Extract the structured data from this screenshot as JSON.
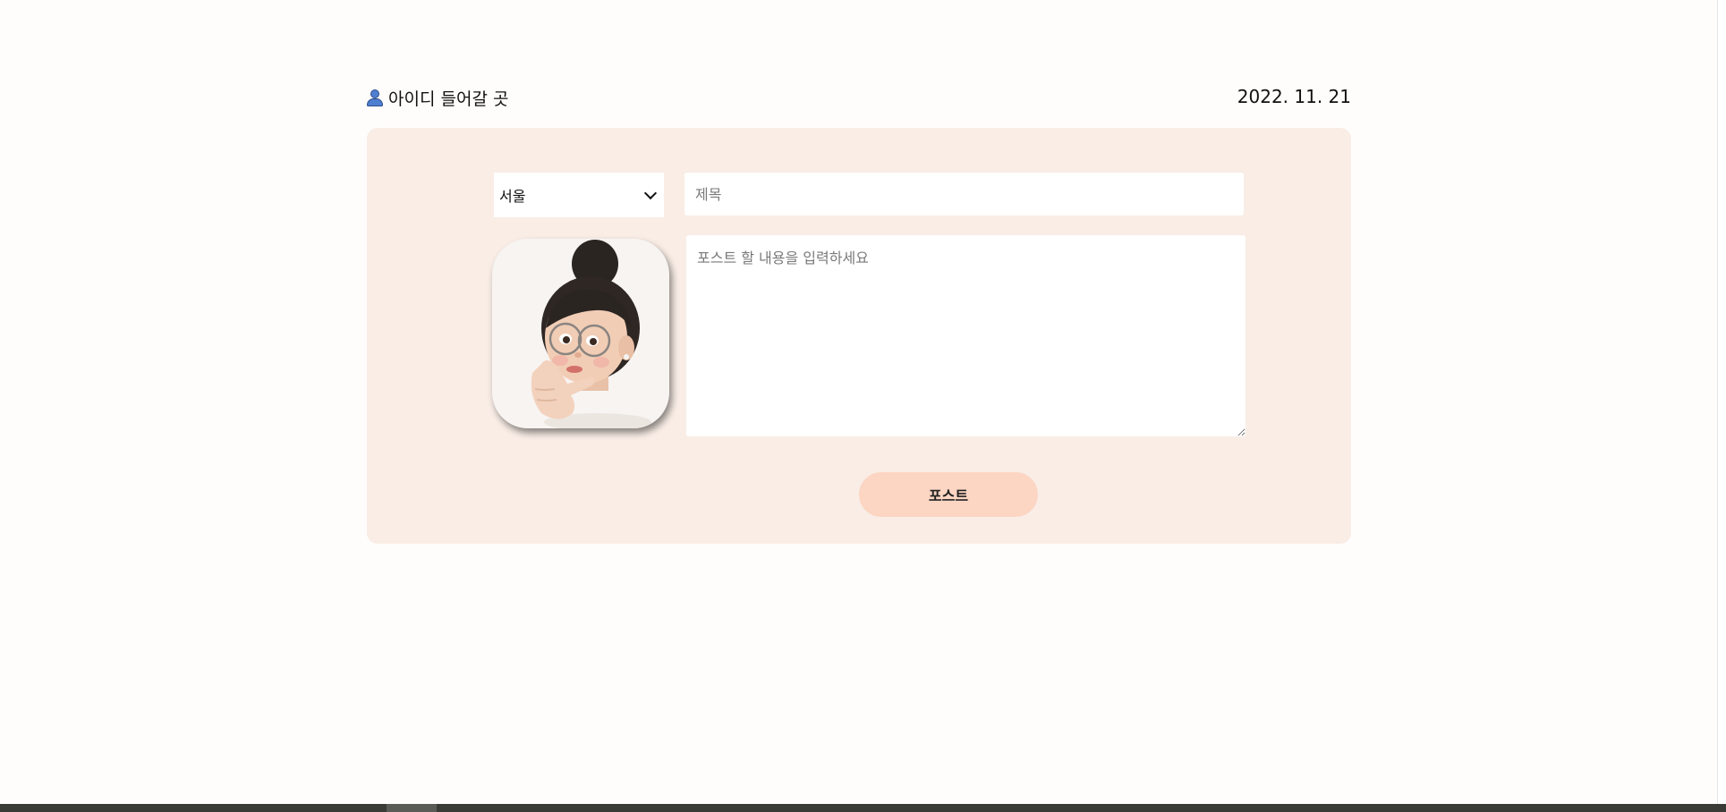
{
  "header": {
    "user_icon": "person-icon",
    "user_id_label": "아이디 들어갈 곳",
    "date": "2022. 11. 21"
  },
  "form": {
    "region_select": {
      "selected": "서울",
      "icon": "chevron-down-icon"
    },
    "title_placeholder": "제목",
    "content_placeholder": "포스트 할 내용을 입력하세요",
    "avatar_image": "memoji-avatar",
    "post_button_label": "포스트"
  },
  "colors": {
    "card_background": "#f9ede6",
    "button_background": "#fcd5c3",
    "user_icon": "#4f7fd1"
  }
}
